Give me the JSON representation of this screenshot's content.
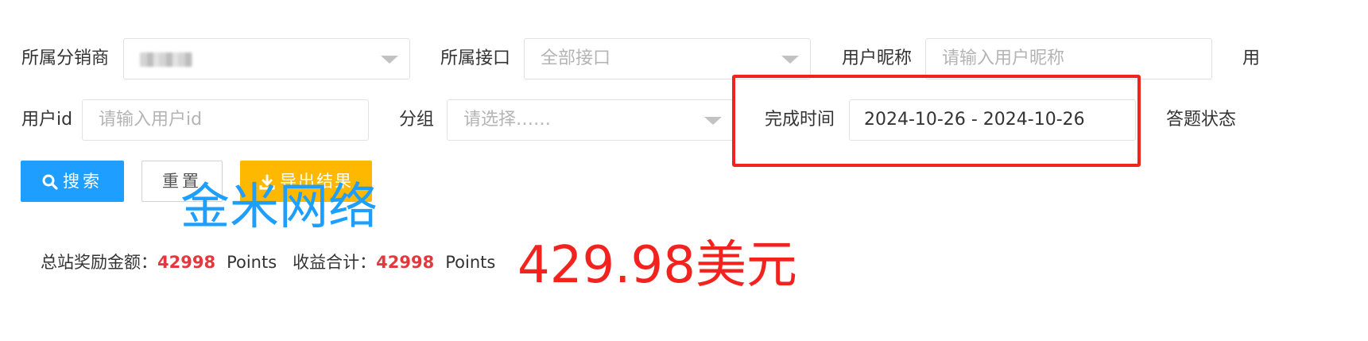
{
  "filters": {
    "distributor": {
      "label": "所属分销商",
      "value": ""
    },
    "interface": {
      "label": "所属接口",
      "placeholder": "全部接口"
    },
    "nickname": {
      "label": "用户昵称",
      "placeholder": "请输入用户昵称"
    },
    "cut_label": "用",
    "user_id": {
      "label": "用户id",
      "placeholder": "请输入用户id"
    },
    "group": {
      "label": "分组",
      "placeholder": "请选择……"
    },
    "finish_time": {
      "label": "完成时间",
      "value": "2024-10-26 - 2024-10-26"
    },
    "answer_status": {
      "label": "答题状态"
    }
  },
  "buttons": {
    "search": "搜索",
    "reset": "重置",
    "export": "导出结果"
  },
  "icons": {
    "search": "search-icon",
    "export": "download-icon",
    "caret": "chevron-down-icon"
  },
  "colors": {
    "primary": "#1e9fff",
    "warn": "#ffb800",
    "highlight": "#f2231e",
    "number": "#e4393c"
  },
  "watermark": "金米网络",
  "stats": {
    "total_reward_label": "总站奖励金额：",
    "total_reward_value": "42998",
    "total_reward_unit": "Points",
    "income_label": "收益合计：",
    "income_value": "42998",
    "income_unit": "Points"
  },
  "annotation": "429.98美元"
}
